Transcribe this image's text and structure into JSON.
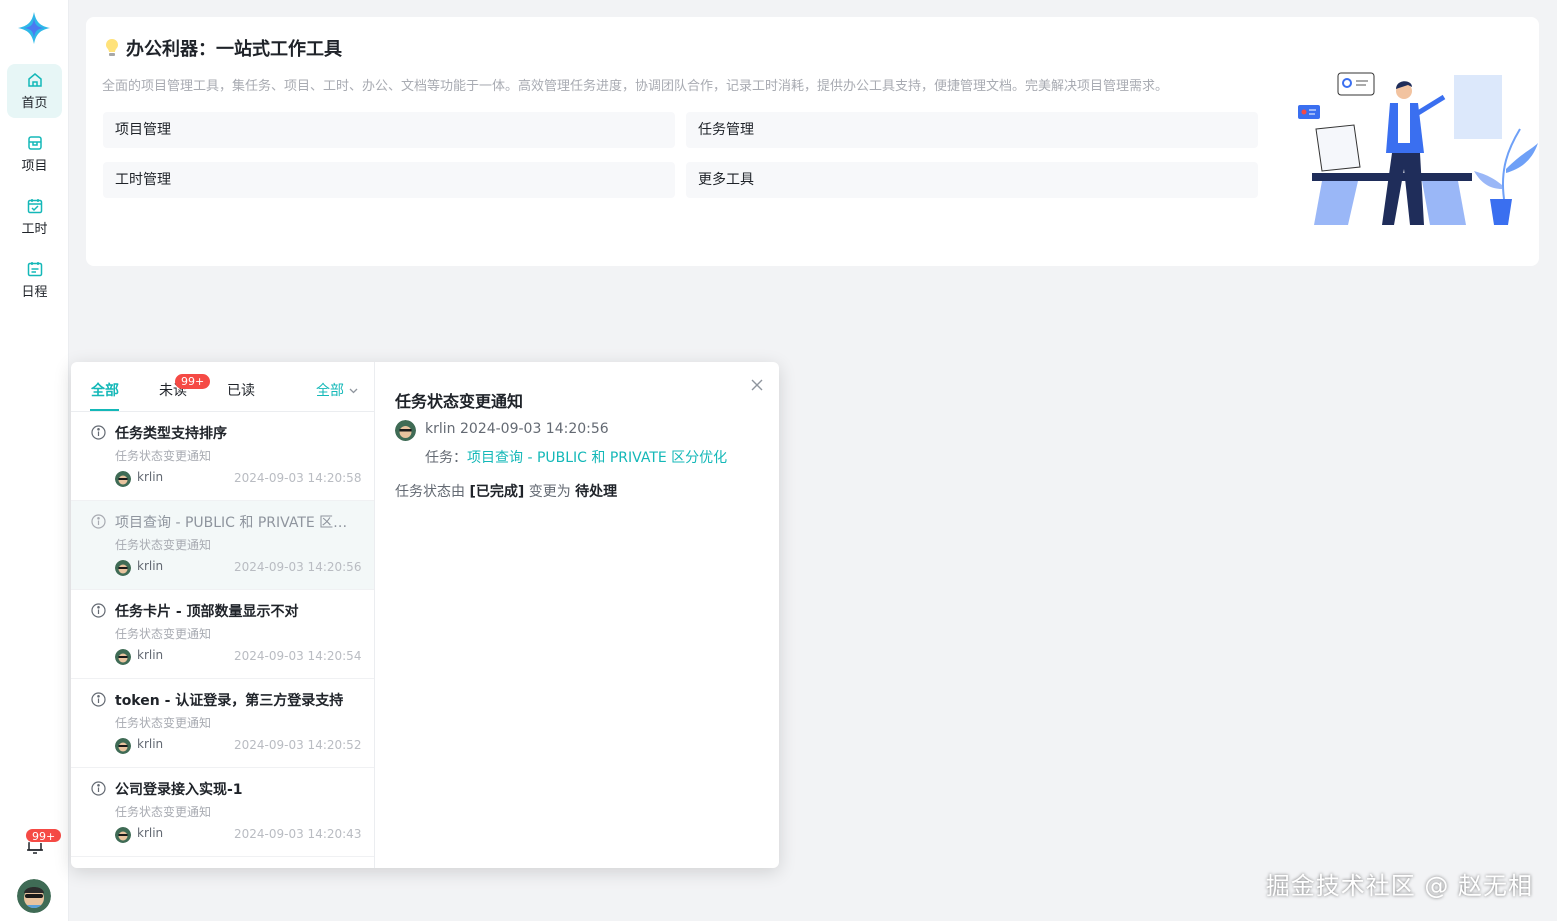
{
  "colors": {
    "accent": "#14b8b8",
    "badge": "#f54a45",
    "background": "#f2f3f5"
  },
  "sidebar": {
    "logo_icon": "sparkle-logo-icon",
    "items": [
      {
        "label": "首页",
        "icon": "home-icon",
        "active": true
      },
      {
        "label": "项目",
        "icon": "project-icon",
        "active": false
      },
      {
        "label": "工时",
        "icon": "calendar-check-icon",
        "active": false
      },
      {
        "label": "日程",
        "icon": "schedule-icon",
        "active": false
      }
    ],
    "bell_icon": "bell-icon",
    "notification_badge": "99+"
  },
  "banner": {
    "icon": "lightbulb-icon",
    "title": "办公利器：一站式工作工具",
    "description": "全面的项目管理工具，集任务、项目、工时、办公、文档等功能于一体。高效管理任务进度，协调团队合作，记录工时消耗，提供办公工具支持，便捷管理文档。完美解决项目管理需求。",
    "tools": [
      "项目管理",
      "任务管理",
      "工时管理",
      "更多工具"
    ]
  },
  "notifications": {
    "tabs": [
      "全部",
      "未读",
      "已读"
    ],
    "unread_badge": "99+",
    "filter_label": "全部",
    "items": [
      {
        "title": "任务类型支持排序",
        "subtitle": "任务状态变更通知",
        "user": "krlin",
        "time": "2024-09-03 14:20:58",
        "read": false
      },
      {
        "title": "项目查询 - PUBLIC 和 PRIVATE 区分优化",
        "subtitle": "任务状态变更通知",
        "user": "krlin",
        "time": "2024-09-03 14:20:56",
        "read": true
      },
      {
        "title": "任务卡片 - 顶部数量显示不对",
        "subtitle": "任务状态变更通知",
        "user": "krlin",
        "time": "2024-09-03 14:20:54",
        "read": false
      },
      {
        "title": "token - 认证登录，第三方登录支持",
        "subtitle": "任务状态变更通知",
        "user": "krlin",
        "time": "2024-09-03 14:20:52",
        "read": false
      },
      {
        "title": "公司登录接入实现-1",
        "subtitle": "任务状态变更通知",
        "user": "krlin",
        "time": "2024-09-03 14:20:43",
        "read": false
      }
    ],
    "detail": {
      "title": "任务状态变更通知",
      "user": "krlin",
      "time": "2024-09-03 14:20:56",
      "task_label": "任务：",
      "task_link": "项目查询 - PUBLIC 和 PRIVATE 区分优化",
      "change_prefix": "任务状态由 ",
      "from_status": "[已完成]",
      "change_mid": " 变更为 ",
      "to_status": "待处理"
    }
  },
  "watermark": "掘金技术社区 @ 赵无相"
}
